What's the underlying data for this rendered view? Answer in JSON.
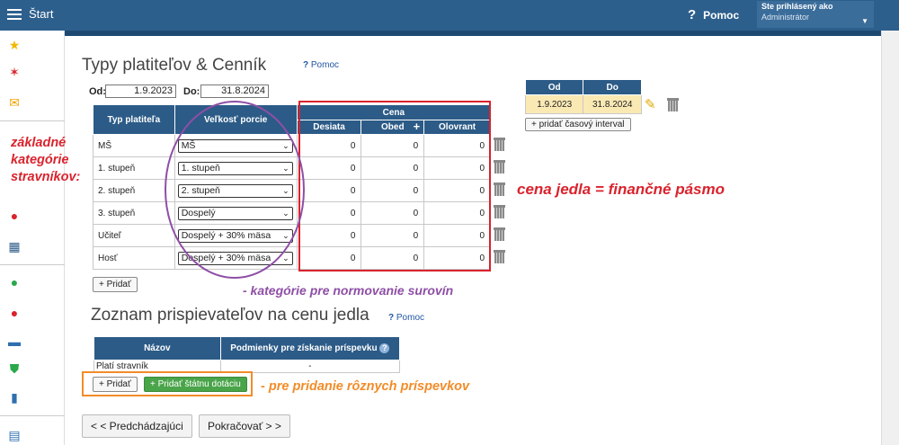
{
  "topbar": {
    "app_title": "Štart",
    "help_label": "Pomoc",
    "user_line1": "Ste prihlásený ako",
    "user_line2": "Administrátor"
  },
  "page": {
    "title": "Typy platiteľov & Cenník",
    "help": "Pomoc",
    "od_label": "Od:",
    "od_value": "1.9.2023",
    "do_label": "Do:",
    "do_value": "31.8.2024"
  },
  "price_table": {
    "headers": {
      "type": "Typ platiteľa",
      "portion": "Veľkosť porcie",
      "price": "Cena",
      "col1": "Desiata",
      "col2": "Obed",
      "col3": "Olovrant"
    },
    "rows": [
      {
        "type": "MŠ",
        "portion": "MŠ",
        "v1": "0",
        "v2": "0",
        "v3": "0"
      },
      {
        "type": "1. stupeň",
        "portion": "1. stupeň",
        "v1": "0",
        "v2": "0",
        "v3": "0"
      },
      {
        "type": "2. stupeň",
        "portion": "2. stupeň",
        "v1": "0",
        "v2": "0",
        "v3": "0"
      },
      {
        "type": "3. stupeň",
        "portion": "Dospelý",
        "v1": "0",
        "v2": "0",
        "v3": "0"
      },
      {
        "type": "Učiteľ",
        "portion": "Dospelý + 30% mäsa",
        "v1": "0",
        "v2": "0",
        "v3": "0"
      },
      {
        "type": "Hosť",
        "portion": "Dospelý + 30% mäsa",
        "v1": "0",
        "v2": "0",
        "v3": "0"
      }
    ],
    "add_label": "+ Pridať"
  },
  "interval_table": {
    "col_od": "Od",
    "col_do": "Do",
    "od": "1.9.2023",
    "do": "31.8.2024",
    "add_label": "+ pridať časový interval"
  },
  "contrib": {
    "title": "Zoznam prispievateľov na cenu jedla",
    "help": "Pomoc",
    "col_name": "Názov",
    "col_cond": "Podmienky pre získanie príspevku",
    "row_name": "Platí stravník",
    "row_cond": "-",
    "add_label": "+ Pridať",
    "add_state_label": "+ Pridať štátnu dotáciu"
  },
  "nav": {
    "prev": "< < Predchádzajúci",
    "next": "Pokračovať > >"
  },
  "annotations": {
    "categories": "základné kategórie stravníkov:",
    "price": "cena jedla = finančné pásmo",
    "norms": "- kategórie pre normovanie surovín",
    "contrib": "- pre pridanie rôznych príspevkov"
  },
  "colors": {
    "header": "#2c5b87",
    "topbar": "#2d5f8d",
    "red": "#d9232d",
    "purple": "#8e4fa6",
    "orange": "#f28c28",
    "green": "#4aa44a"
  },
  "icons": [
    "menu-icon",
    "help-icon",
    "star-icon",
    "wand-icon",
    "mail-icon",
    "user-icon",
    "calendar-icon",
    "check-icon",
    "badge-icon",
    "briefcase-icon",
    "shield-icon",
    "chart-icon",
    "book-icon",
    "pencil-icon",
    "trash-icon"
  ]
}
